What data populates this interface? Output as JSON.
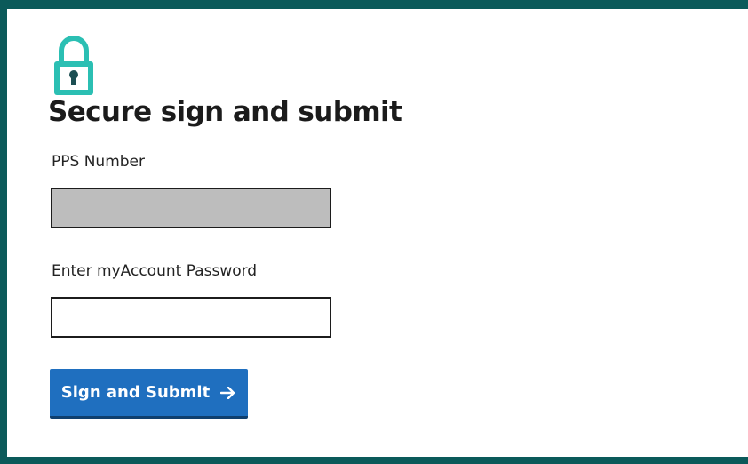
{
  "header": {
    "icon": "lock-icon",
    "title": "Secure sign and submit"
  },
  "form": {
    "pps_label": "PPS Number",
    "pps_value": "",
    "password_label": "Enter myAccount Password",
    "password_value": "",
    "submit_label": "Sign and Submit",
    "submit_icon": "arrow-right-icon"
  },
  "colors": {
    "frame": "#0b5a5a",
    "lock": "#2bbfb3",
    "button": "#1f6fbf",
    "pps_field_fill": "#bdbdbd"
  }
}
